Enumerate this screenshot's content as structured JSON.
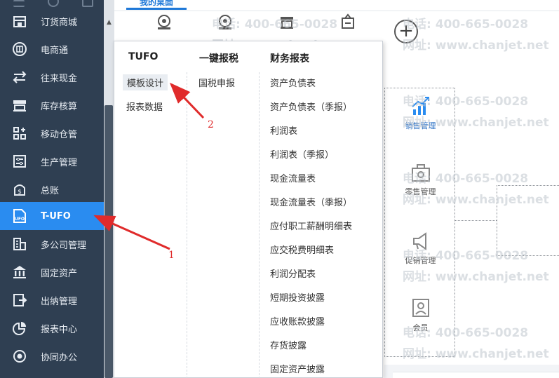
{
  "sidebar": {
    "items": [
      {
        "label": "订货商城",
        "icon": "store-icon"
      },
      {
        "label": "电商通",
        "icon": "ecommerce-icon"
      },
      {
        "label": "往来现金",
        "icon": "exchange-icon"
      },
      {
        "label": "库存核算",
        "icon": "warehouse-icon"
      },
      {
        "label": "移动仓管",
        "icon": "mobile-warehouse-icon"
      },
      {
        "label": "生产管理",
        "icon": "production-icon"
      },
      {
        "label": "总账",
        "icon": "ledger-icon"
      },
      {
        "label": "T-UFO",
        "icon": "ufo-icon",
        "active": true
      },
      {
        "label": "多公司管理",
        "icon": "building-icon"
      },
      {
        "label": "固定资产",
        "icon": "bank-icon"
      },
      {
        "label": "出纳管理",
        "icon": "cashier-icon"
      },
      {
        "label": "报表中心",
        "icon": "pie-chart-icon"
      },
      {
        "label": "协同办公",
        "icon": "collaboration-icon"
      }
    ]
  },
  "tabs": {
    "active": "我的桌面"
  },
  "dropdown": {
    "col1": {
      "title": "TUFO",
      "items": [
        "模板设计",
        "报表数据"
      ]
    },
    "col2": {
      "title": "一键报税",
      "items": [
        "国税申报"
      ]
    },
    "col3": {
      "title": "财务报表",
      "items": [
        "资产负债表",
        "资产负债表（季报）",
        "利润表",
        "利润表（季报）",
        "现金流量表",
        "现金流量表（季报）",
        "应付职工薪酬明细表",
        "应交税费明细表",
        "利润分配表",
        "短期投资披露",
        "应收账款披露",
        "存货披露",
        "固定资产披露"
      ]
    }
  },
  "flow": {
    "items": [
      "销售管理",
      "零售管理",
      "促销管理",
      "会员"
    ]
  },
  "watermark": {
    "phone": "电话: 400-665-0028",
    "site": "网址: www.chanjet.net"
  },
  "annotations": {
    "label1": "1",
    "label2": "2"
  },
  "colors": {
    "sidebar": "#2f3f52",
    "active": "#2a8cf0",
    "annotation": "#e02b2b"
  }
}
